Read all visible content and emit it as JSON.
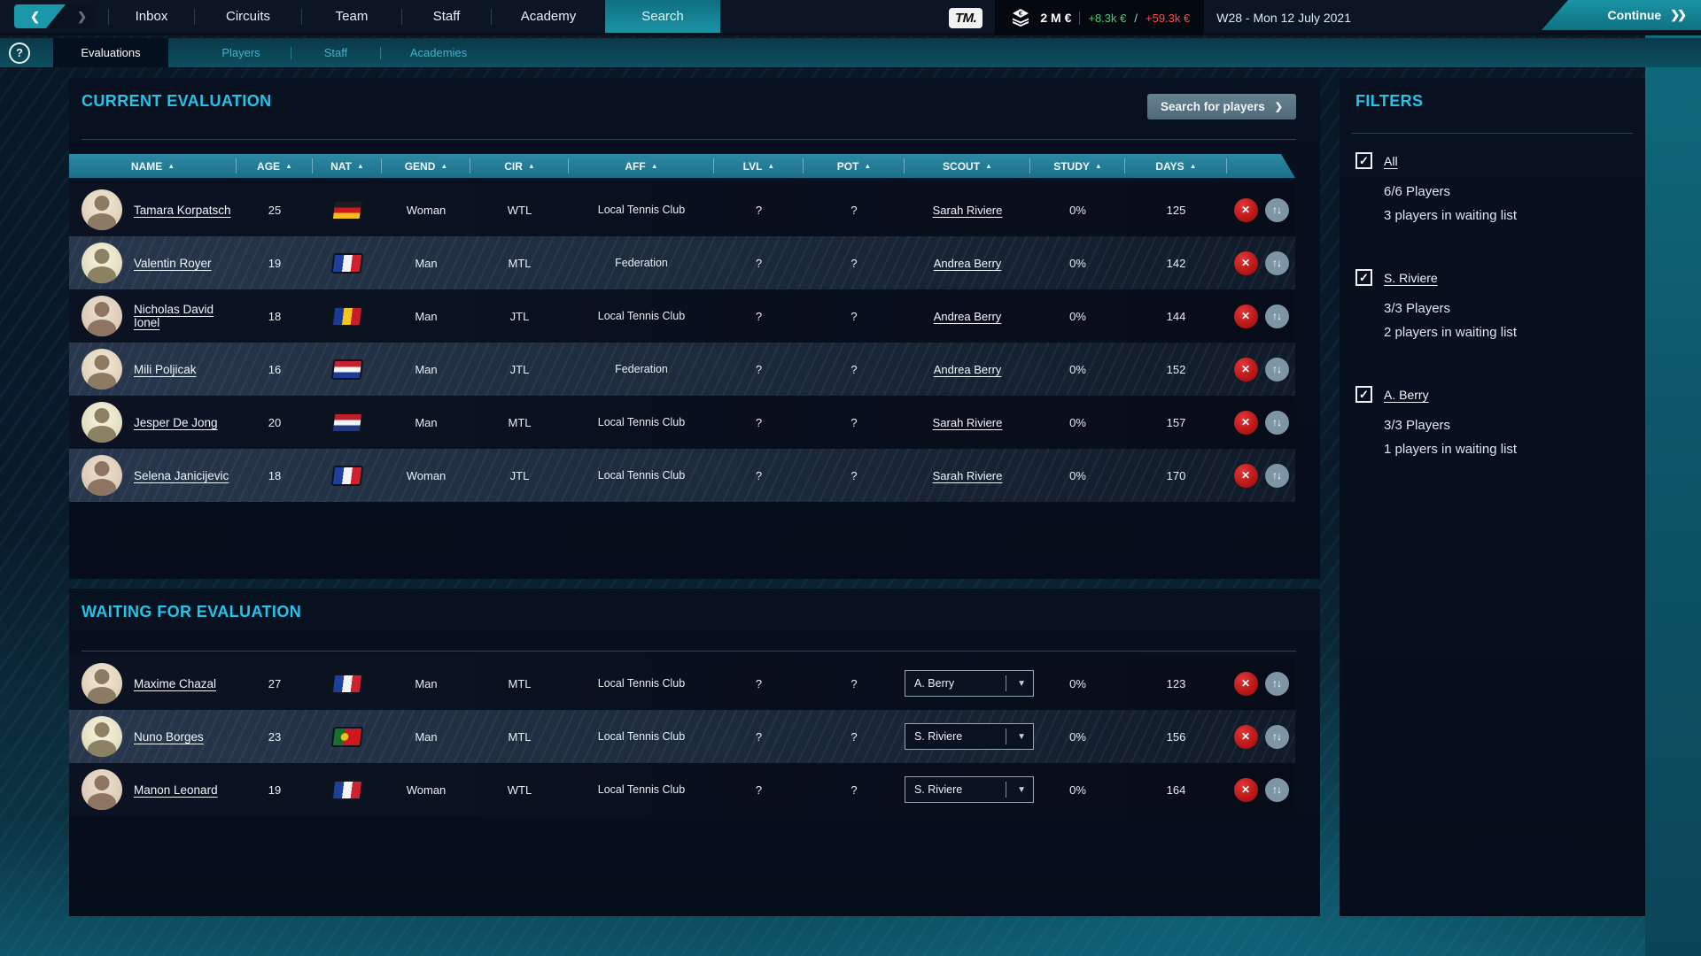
{
  "ui": {
    "back_chevron": "❮",
    "forward_chevron": "❯",
    "double_chevron": "❯❯",
    "chevron": "❯",
    "sort_asc": "▲",
    "caret_down": "▼",
    "close_glyph": "✕",
    "updown_glyph": "↑↓",
    "check_glyph": "✓",
    "help_glyph": "?",
    "pipe": "|",
    "slash": "/"
  },
  "colors": {
    "accent_cyan": "#23c4ea",
    "nav_teal": "#1b93a5",
    "table_header_teal": "#2c8aa4",
    "positive_green": "#3ed06e",
    "negative_red": "#ff4b4b",
    "remove_red": "#c11c1c",
    "panel_bg": "#070e1b"
  },
  "top_nav": {
    "tabs": [
      "Inbox",
      "Circuits",
      "Team",
      "Staff",
      "Academy",
      "Search"
    ],
    "active_tab": "Search",
    "logo": "TM.",
    "balance": "2 M €",
    "weekly_gain": "+8.3k €",
    "weekly_loss": "+59.3k €",
    "date": "W28 - Mon 12 July 2021",
    "continue_label": "Continue"
  },
  "sub_nav": {
    "tabs": [
      "Evaluations",
      "Players",
      "Staff",
      "Academies"
    ],
    "active_tab": "Evaluations"
  },
  "current_evaluation": {
    "title": "CURRENT EVALUATION",
    "search_button_label": "Search for players",
    "columns": [
      "NAME",
      "AGE",
      "NAT",
      "GEND",
      "CIR",
      "AFF",
      "LVL",
      "POT",
      "SCOUT",
      "STUDY",
      "DAYS"
    ],
    "rows": [
      {
        "name": "Tamara Korpatsch",
        "age": "25",
        "nat": "de",
        "gend": "Woman",
        "cir": "WTL",
        "aff": "Local Tennis Club",
        "lvl": "?",
        "pot": "?",
        "scout": "Sarah Riviere",
        "study": "0%",
        "days": "125"
      },
      {
        "name": "Valentin Royer",
        "age": "19",
        "nat": "fr",
        "gend": "Man",
        "cir": "MTL",
        "aff": "Federation",
        "lvl": "?",
        "pot": "?",
        "scout": "Andrea Berry",
        "study": "0%",
        "days": "142"
      },
      {
        "name": "Nicholas David Ionel",
        "age": "18",
        "nat": "ro",
        "gend": "Man",
        "cir": "JTL",
        "aff": "Local Tennis Club",
        "lvl": "?",
        "pot": "?",
        "scout": "Andrea Berry",
        "study": "0%",
        "days": "144"
      },
      {
        "name": "Mili Poljicak",
        "age": "16",
        "nat": "hr",
        "gend": "Man",
        "cir": "JTL",
        "aff": "Federation",
        "lvl": "?",
        "pot": "?",
        "scout": "Andrea Berry",
        "study": "0%",
        "days": "152"
      },
      {
        "name": "Jesper De Jong",
        "age": "20",
        "nat": "nl",
        "gend": "Man",
        "cir": "MTL",
        "aff": "Local Tennis Club",
        "lvl": "?",
        "pot": "?",
        "scout": "Sarah Riviere",
        "study": "0%",
        "days": "157"
      },
      {
        "name": "Selena Janicijevic",
        "age": "18",
        "nat": "fr",
        "gend": "Woman",
        "cir": "JTL",
        "aff": "Local Tennis Club",
        "lvl": "?",
        "pot": "?",
        "scout": "Sarah Riviere",
        "study": "0%",
        "days": "170"
      }
    ]
  },
  "waiting_for_evaluation": {
    "title": "WAITING FOR EVALUATION",
    "rows": [
      {
        "name": "Maxime Chazal",
        "age": "27",
        "nat": "fr",
        "gend": "Man",
        "cir": "MTL",
        "aff": "Local Tennis Club",
        "lvl": "?",
        "pot": "?",
        "scout_selected": "A. Berry",
        "study": "0%",
        "days": "123"
      },
      {
        "name": "Nuno Borges",
        "age": "23",
        "nat": "pt",
        "gend": "Man",
        "cir": "MTL",
        "aff": "Local Tennis Club",
        "lvl": "?",
        "pot": "?",
        "scout_selected": "S. Riviere",
        "study": "0%",
        "days": "156"
      },
      {
        "name": "Manon Leonard",
        "age": "19",
        "nat": "fr",
        "gend": "Woman",
        "cir": "WTL",
        "aff": "Local Tennis Club",
        "lvl": "?",
        "pot": "?",
        "scout_selected": "S. Riviere",
        "study": "0%",
        "days": "164"
      }
    ]
  },
  "filters": {
    "title": "FILTERS",
    "groups": [
      {
        "label": "All",
        "checked": true,
        "players": "6/6 Players",
        "waiting": "3 players in waiting list"
      },
      {
        "label": "S. Riviere",
        "checked": true,
        "players": "3/3 Players",
        "waiting": "2 players in waiting list"
      },
      {
        "label": "A. Berry",
        "checked": true,
        "players": "3/3 Players",
        "waiting": "1 players in waiting list"
      }
    ]
  }
}
